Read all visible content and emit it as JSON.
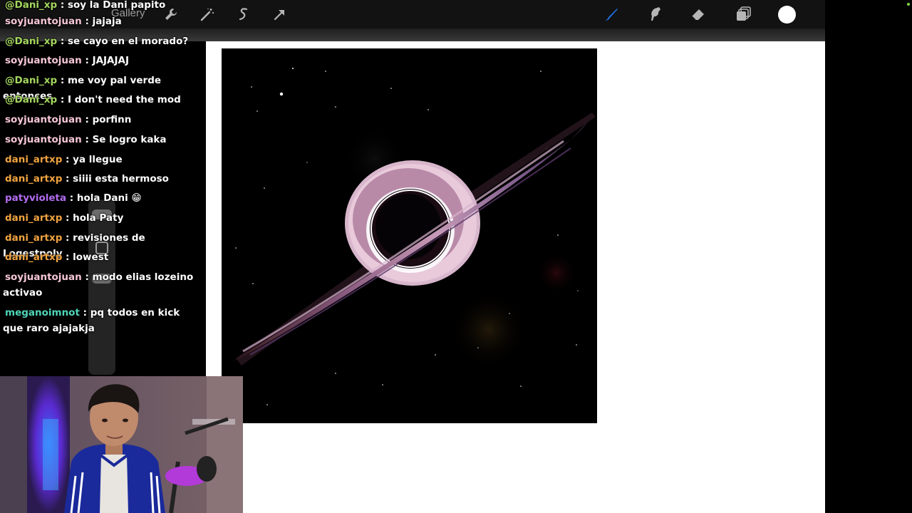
{
  "toolbar": {
    "gallery_label": "Gallery",
    "tools_left": [
      "wrench-icon",
      "magic-wand-icon",
      "selection-icon",
      "transform-arrow-icon"
    ],
    "tools_right": [
      "brush-icon",
      "smudge-icon",
      "eraser-icon",
      "layers-icon",
      "color-swatch"
    ],
    "active_color": "#1e6fd9",
    "swatch_color": "#ffffff"
  },
  "colors": {
    "toolbar_bg": "#121212",
    "canvas_bg": "#ffffff",
    "artwork_bg": "#000000"
  },
  "chat": {
    "messages": [
      {
        "user": "@Dani_xp",
        "text": " : soy la Dani papito",
        "color": "green"
      },
      {
        "user": "soyjuantojuan",
        "text": " : jajaja",
        "color": "pink"
      },
      {
        "user": "@Dani_xp",
        "text": " : se cayo en el morado?",
        "color": "green"
      },
      {
        "user": "soyjuantojuan",
        "text": " : JAJAJAJ",
        "color": "pink"
      },
      {
        "user": "@Dani_xp",
        "text": " : me voy pal verde entonces",
        "color": "green"
      },
      {
        "user": "@Dani_xp",
        "text": " : I don't need the mod",
        "color": "green"
      },
      {
        "user": "soyjuantojuan",
        "text": " : porfinn",
        "color": "pink"
      },
      {
        "user": "soyjuantojuan",
        "text": " : Se logro kaka",
        "color": "pink"
      },
      {
        "user": "dani_artxp",
        "text": " : ya llegue",
        "color": "orange"
      },
      {
        "user": "dani_artxp",
        "text": " : siiii esta hermoso",
        "color": "orange"
      },
      {
        "user": "patyvioleta",
        "text": " : hola Dani 😁",
        "color": "purple"
      },
      {
        "user": "dani_artxp",
        "text": " : hola Paty",
        "color": "orange"
      },
      {
        "user": "dani_artxp",
        "text": " : revisiones de Loqestpoly",
        "color": "orange"
      },
      {
        "user": "dani_artxp",
        "text": " : lowest",
        "color": "orange"
      },
      {
        "user": "soyjuantojuan",
        "text": " : modo elias lozeino activao",
        "color": "pink"
      },
      {
        "user": "meganoimnot",
        "text": " : pq todos en kick que raro ajajakja",
        "color": "teal"
      }
    ]
  },
  "artwork": {
    "subject": "black-hole-illustration"
  }
}
